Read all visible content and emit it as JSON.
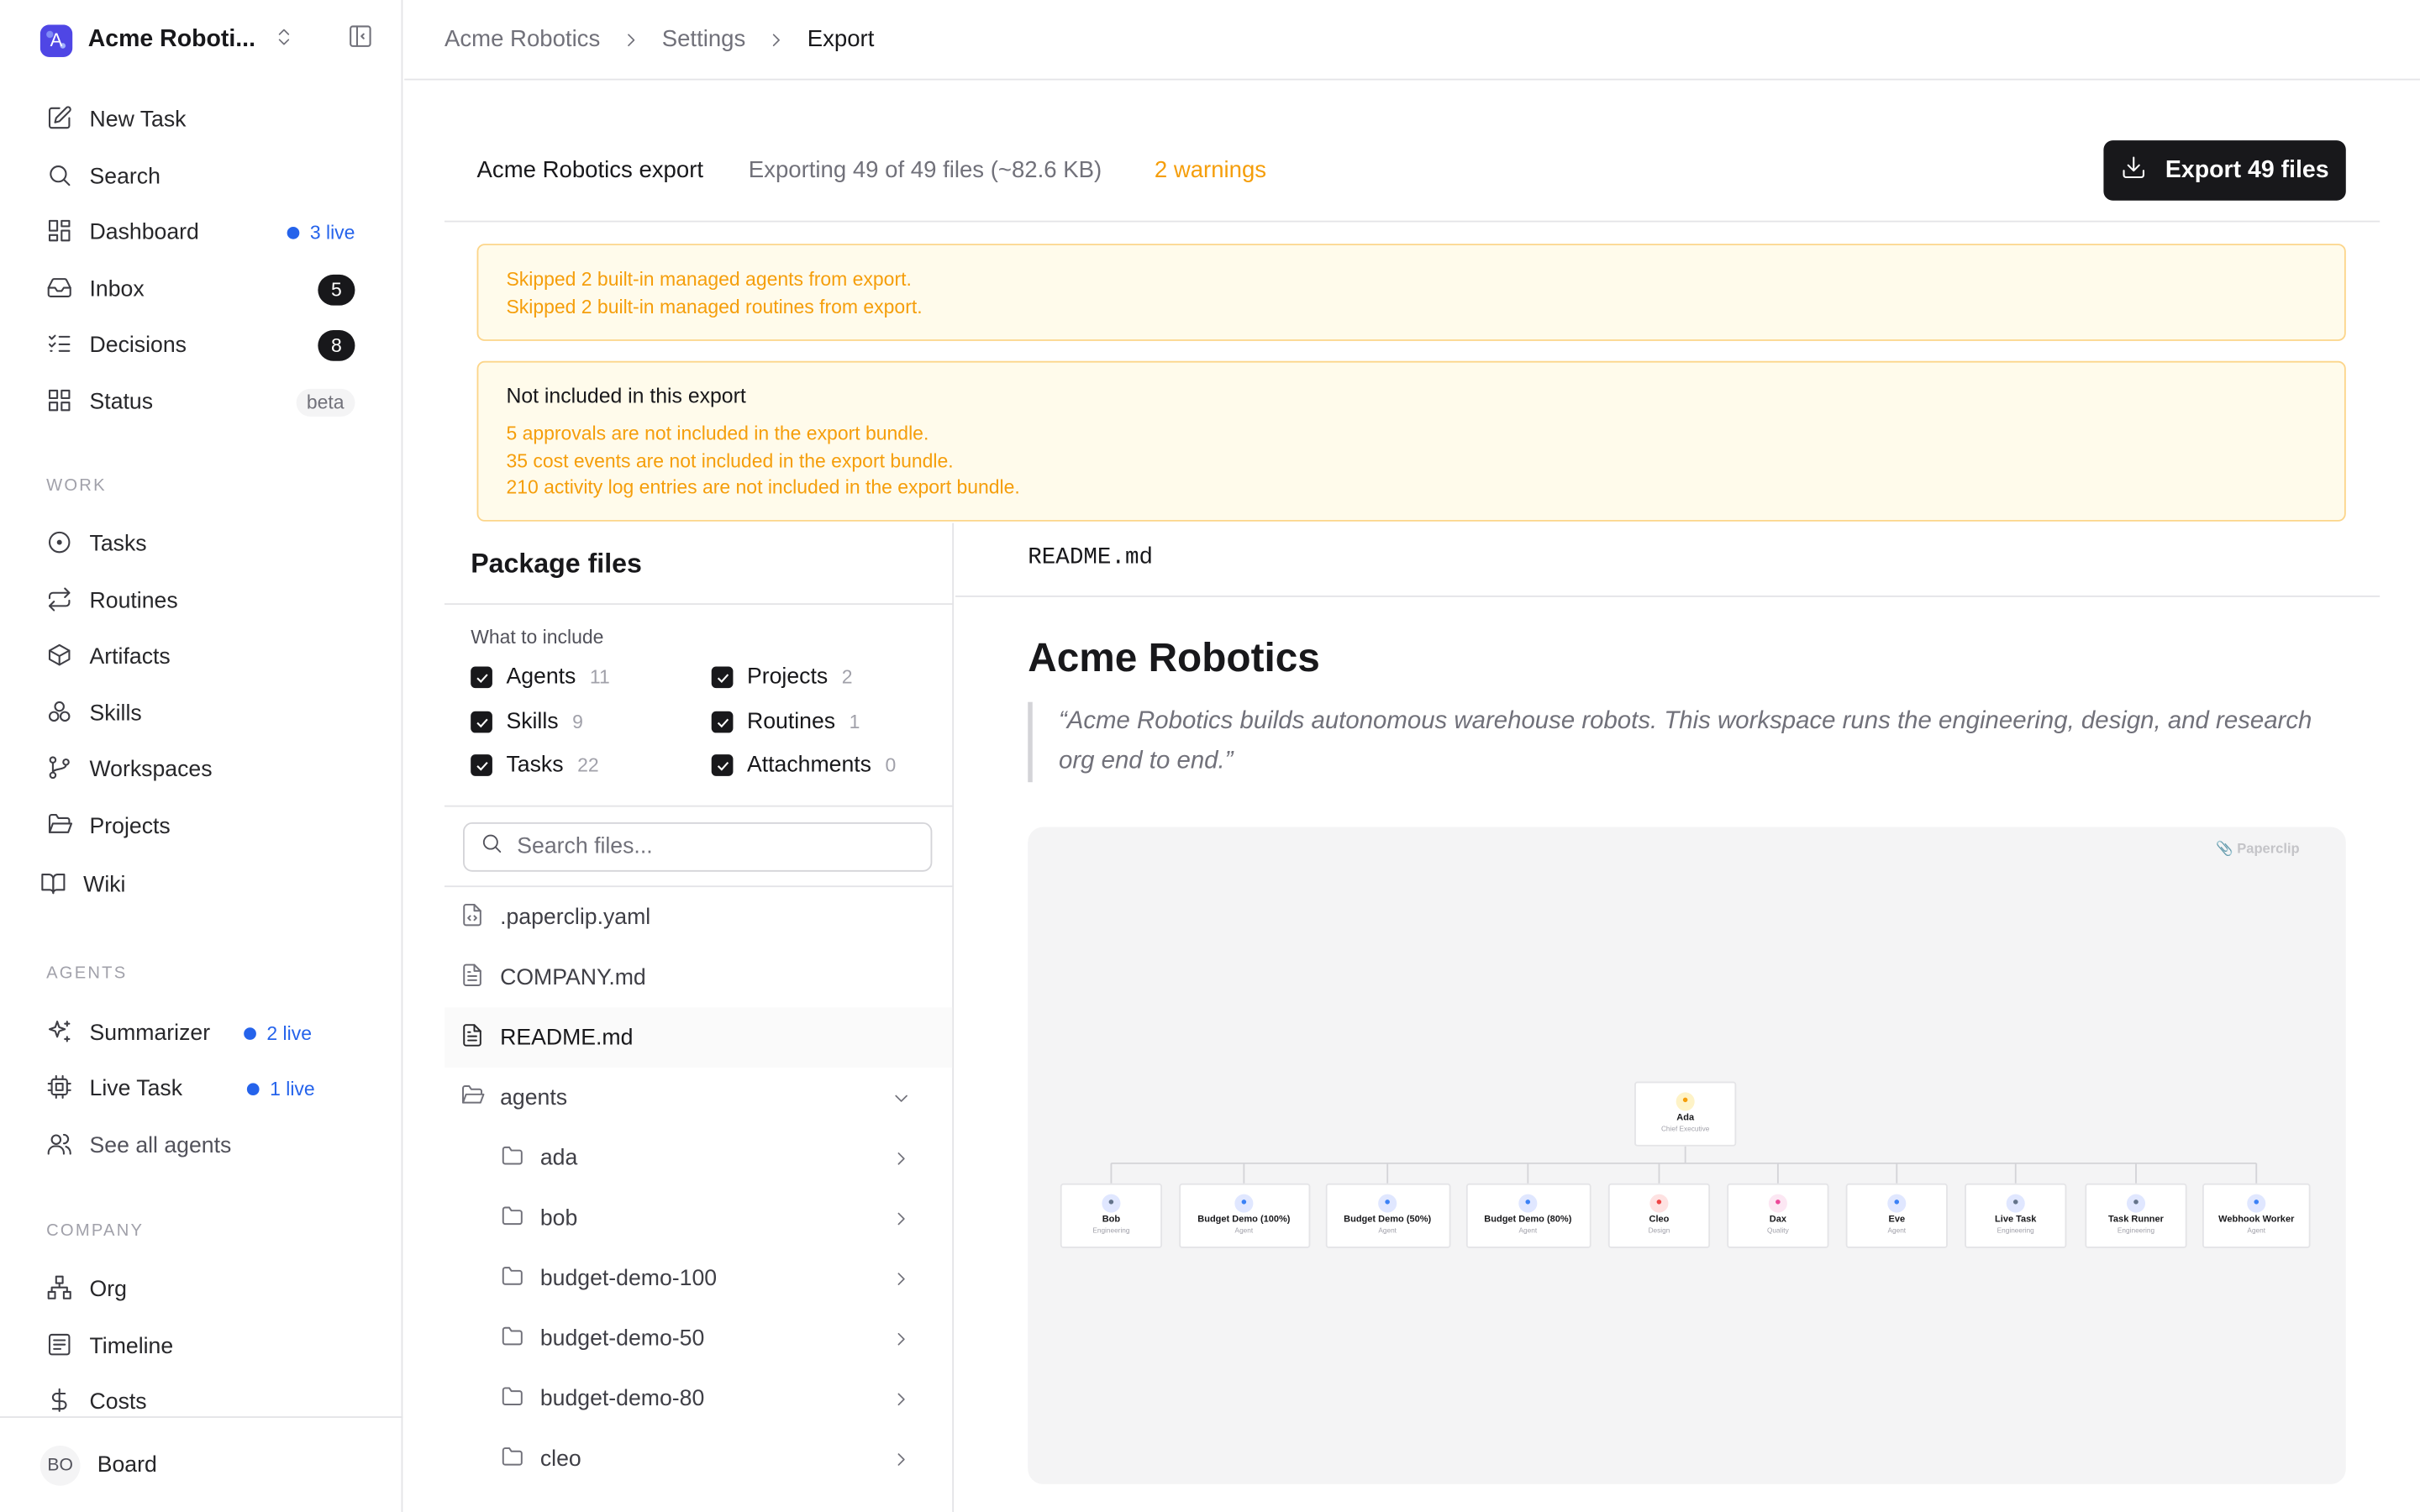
{
  "workspace": {
    "name": "Acme Robotics",
    "name_display": "Acme Roboti...",
    "logo_letter": "A"
  },
  "sidebar": {
    "top_items": [
      {
        "label": "New Task",
        "icon": "edit-icon"
      },
      {
        "label": "Search",
        "icon": "search-icon"
      },
      {
        "label": "Dashboard",
        "icon": "dashboard-icon",
        "live": "3 live"
      },
      {
        "label": "Inbox",
        "icon": "inbox-icon",
        "count": "5"
      },
      {
        "label": "Decisions",
        "icon": "list-checks-icon",
        "count": "8"
      },
      {
        "label": "Status",
        "icon": "grid-icon",
        "badge": "beta"
      }
    ],
    "work_label": "WORK",
    "work_items": [
      {
        "label": "Tasks",
        "icon": "circle-dot-icon"
      },
      {
        "label": "Routines",
        "icon": "repeat-icon"
      },
      {
        "label": "Artifacts",
        "icon": "box-icon"
      },
      {
        "label": "Skills",
        "icon": "boxes-icon"
      },
      {
        "label": "Workspaces",
        "icon": "git-branch-icon"
      },
      {
        "label": "Projects",
        "icon": "folder-open-icon"
      },
      {
        "label": "Wiki",
        "icon": "book-icon"
      }
    ],
    "agents_label": "AGENTS",
    "agent_items": [
      {
        "label": "Summarizer",
        "icon": "sparkles-icon",
        "live": "2 live"
      },
      {
        "label": "Live Task",
        "icon": "cpu-icon",
        "live": "1 live"
      },
      {
        "label": "See all agents",
        "icon": "users-icon"
      }
    ],
    "company_label": "COMPANY",
    "company_items": [
      {
        "label": "Org",
        "icon": "network-icon"
      },
      {
        "label": "Timeline",
        "icon": "timeline-icon"
      },
      {
        "label": "Costs",
        "icon": "dollar-icon"
      }
    ],
    "footer": {
      "initials": "BO",
      "name": "Board"
    }
  },
  "breadcrumb": [
    "Acme Robotics",
    "Settings",
    "Export"
  ],
  "export": {
    "title": "Acme Robotics export",
    "summary": "Exporting 49 of 49 files (~82.6 KB)",
    "warnings": "2 warnings",
    "button_label": "Export 49 files"
  },
  "alerts": {
    "skipped": [
      "Skipped 2 built-in managed agents from export.",
      "Skipped 2 built-in managed routines from export."
    ],
    "not_included_title": "Not included in this export",
    "not_included": [
      "5 approvals are not included in the export bundle.",
      "35 cost events are not included in the export bundle.",
      "210 activity log entries are not included in the export bundle."
    ]
  },
  "files_panel": {
    "title": "Package files",
    "include_label": "What to include",
    "include": [
      {
        "label": "Agents",
        "count": "11",
        "checked": true
      },
      {
        "label": "Projects",
        "count": "2",
        "checked": true
      },
      {
        "label": "Skills",
        "count": "9",
        "checked": true
      },
      {
        "label": "Routines",
        "count": "1",
        "checked": true
      },
      {
        "label": "Tasks",
        "count": "22",
        "checked": true
      },
      {
        "label": "Attachments",
        "count": "0",
        "checked": true
      }
    ],
    "search_placeholder": "Search files...",
    "files": [
      {
        "name": ".paperclip.yaml",
        "icon": "file-code-icon"
      },
      {
        "name": "COMPANY.md",
        "icon": "file-text-icon"
      },
      {
        "name": "README.md",
        "icon": "file-text-icon",
        "selected": true
      },
      {
        "name": "agents",
        "icon": "folder-open-icon",
        "expanded": true
      },
      {
        "name": "ada",
        "icon": "folder-icon"
      },
      {
        "name": "bob",
        "icon": "folder-icon"
      },
      {
        "name": "budget-demo-100",
        "icon": "folder-icon"
      },
      {
        "name": "budget-demo-50",
        "icon": "folder-icon"
      },
      {
        "name": "budget-demo-80",
        "icon": "folder-icon"
      },
      {
        "name": "cleo",
        "icon": "folder-icon"
      }
    ]
  },
  "preview": {
    "filename": "README.md",
    "heading": "Acme Robotics",
    "quote": "“Acme Robotics builds autonomous warehouse robots. This workspace runs the engineering, design, and research org end to end.”",
    "watermark": "Paperclip",
    "org": {
      "root": {
        "name": "Ada",
        "role": "Chief Executive",
        "icon_color": "#f59e0b",
        "bg": "#fef3c7"
      },
      "children": [
        {
          "name": "Bob",
          "role": "Engineering",
          "icon_color": "#64748b",
          "bg": "#e0e7ff"
        },
        {
          "name": "Budget Demo (100%)",
          "role": "Agent",
          "icon_color": "#3b82f6",
          "bg": "#e0e7ff"
        },
        {
          "name": "Budget Demo (50%)",
          "role": "Agent",
          "icon_color": "#3b82f6",
          "bg": "#e0e7ff"
        },
        {
          "name": "Budget Demo (80%)",
          "role": "Agent",
          "icon_color": "#3b82f6",
          "bg": "#e0e7ff"
        },
        {
          "name": "Cleo",
          "role": "Design",
          "icon_color": "#ef4444",
          "bg": "#fee2e2"
        },
        {
          "name": "Dax",
          "role": "Quality",
          "icon_color": "#ec4899",
          "bg": "#fce7f3"
        },
        {
          "name": "Eve",
          "role": "Agent",
          "icon_color": "#3b82f6",
          "bg": "#e0e7ff"
        },
        {
          "name": "Live Task",
          "role": "Engineering",
          "icon_color": "#64748b",
          "bg": "#e0e7ff"
        },
        {
          "name": "Task Runner",
          "role": "Engineering",
          "icon_color": "#64748b",
          "bg": "#e0e7ff"
        },
        {
          "name": "Webhook Worker",
          "role": "Agent",
          "icon_color": "#3b82f6",
          "bg": "#e0e7ff"
        }
      ]
    }
  }
}
